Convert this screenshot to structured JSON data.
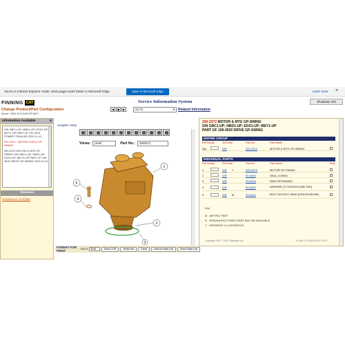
{
  "ie_bar": {
    "message": "You're in Internet Explorer mode. Most pages work better in Microsoft Edge.",
    "edge_button": "Open in Microsoft Edge",
    "learn_more": "Learn more",
    "close": "×"
  },
  "header": {
    "logo_word": "FINNING",
    "logo_cat": "CAT",
    "title": "Service Information System",
    "shutdown": "Shutdown SIS",
    "change_product": "Change Product/Part Configuration",
    "model": "Model: 330D EXCAVATOR MEY",
    "goto_value": "Go To",
    "related": "Related Information"
  },
  "left_panel": {
    "header": "Information Available",
    "close": "X",
    "entry1": "S/N GBC1-UP; NBD1-UP; EDX1-UP; MEY1-UP PART OF 191-2576 POWER TRAIN AR 2020-11-01",
    "entry2_sel": "200-2372 - MOTOR & MTG GP-SWING",
    "entry3": "200-2372 MOTOR & MTG GP-SWING S/N GBC1-UP; NBD1-UP; EDX1-UP; MEY1-UP PART OF 199-4530 DRIVE GP-SWING 2020-11-01",
    "sections": "Sections",
    "sections_link": "HYDRAULIC SYSTEM"
  },
  "graphic": {
    "label": "Graphic Only",
    "views_label": "Views:",
    "views_value": "pictel",
    "part_no_label": "Part No.:",
    "part_no_value": "2003371",
    "callouts": [
      "1",
      "2",
      "3",
      "4",
      "5"
    ]
  },
  "print_bar": {
    "label": "FORMAT FOR PRINT",
    "small": "SMCS",
    "select_value": "5058",
    "buttons": [
      "View CCR",
      "Select All",
      "Clear",
      "Add to Parts List",
      "View Parts List"
    ]
  },
  "right_panel": {
    "title_red": "200-2372",
    "title_line1": "MOTOR & MTG GP-SWING",
    "title_line2": "S/N GBC1-UP; NBD1-UP; EDX1-UP; MEY1-UP",
    "title_line3": "PART OF 199-4530 DRIVE GP-SWING",
    "entire_group": "ENTIRE GROUP",
    "individual_parts": "INDIVIDUAL PARTS",
    "col_headers": [
      "Ref No",
      "Qty",
      "SIS Note",
      "Part No",
      "Part Name",
      "Req"
    ],
    "entire_row": {
      "no": "Qty",
      "sr": "S/R",
      "note": "",
      "pn": "200-2372",
      "name": "MOTOR & MTG GP-SWING"
    },
    "rows": [
      {
        "no": "1",
        "sr": "S/R",
        "note": "Y",
        "pn": "200-2373",
        "name": "MOTOR GP-SWING"
      },
      {
        "no": "2",
        "sr": "S/R",
        "note": "",
        "pn": "8T-6404",
        "name": "SEAL-O-RING"
      },
      {
        "no": "3",
        "sr": "S/R",
        "note": "",
        "pn": "9V-5204",
        "name": "RING-RETAINING"
      },
      {
        "no": "4",
        "sr": "S/R",
        "note": "",
        "pn": "9V-8257",
        "name": "WASHER (17.5X30X3.5-MM THK)"
      },
      {
        "no": "5",
        "sr": "S/R",
        "note": "M",
        "pn": "9V-8201",
        "name": "BOLT-SOCKET HEAD (M16X2X45-MM)"
      }
    ],
    "key_title": "Key:",
    "key_items": [
      "M - METRIC PART",
      "R - REMANUFACTURED PART MAY BE AVAILABLE",
      "Y - SEPARATE ILLUSTRATION"
    ],
    "copyright": "Copyright 2001 - 2020 Caterpillar Inc.",
    "date": "Fri Apr 21 10:05:48 PST 2023"
  }
}
